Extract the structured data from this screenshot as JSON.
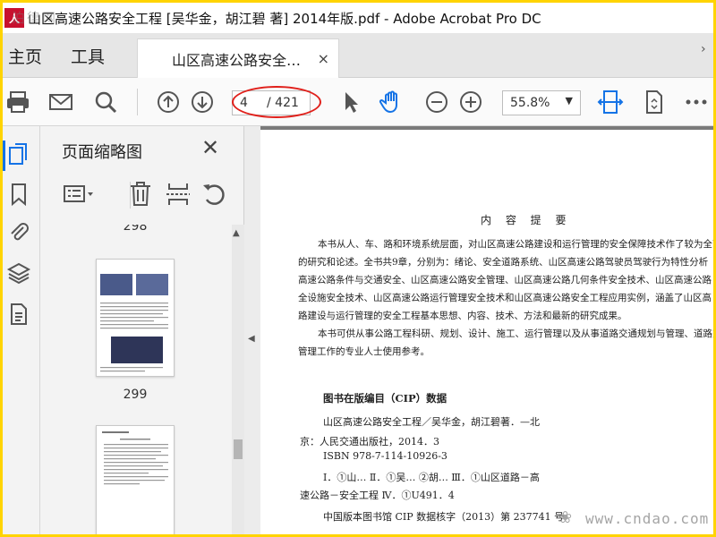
{
  "window": {
    "title": "山区高速公路安全工程 [吴华金，胡江碧 著] 2014年版.pdf - Adobe Acrobat Pro DC",
    "app_icon": "acrobat-icon",
    "watermark_top": "泊律网"
  },
  "menu": {
    "home": "主页",
    "tools": "工具"
  },
  "tab": {
    "label": "山区高速公路安全…",
    "close": "×"
  },
  "toolbar": {
    "icons": [
      "print-icon",
      "email-icon",
      "search-icon",
      "prev-page-icon",
      "next-page-icon",
      "select-cursor-icon",
      "hand-tool-icon",
      "zoom-out-icon",
      "zoom-in-icon",
      "fit-width-icon",
      "page-layout-icon",
      "more-icon"
    ],
    "page_current": "4",
    "page_total": "/ 421",
    "zoom": "55.8%"
  },
  "left_rail": {
    "icons": [
      "thumbnails-icon",
      "bookmark-icon",
      "attachment-icon",
      "layers-icon",
      "page-content-icon"
    ]
  },
  "thumbnail_panel": {
    "title": "页面缩略图",
    "close": "✕",
    "tools": [
      "options-icon",
      "delete-icon",
      "extract-icon",
      "rotate-icon"
    ],
    "partial_label": "298",
    "page_labels": [
      "299"
    ]
  },
  "document": {
    "heading": "内 容 提 要",
    "paragraph_lines": [
      "本书从人、车、路和环境系统层面，对山区高速公路建设和运行管理的安全保障技术作了较为全面",
      "的研究和论述。全书共9章，分别为：绪论、安全道路系统、山区高速公路驾驶员驾驶行为特性分析",
      "高速公路条件与交通安全、山区高速公路安全管理、山区高速公路几何条件安全技术、山区高速公路",
      "全设施安全技术、山区高速公路运行管理安全技术和山区高速公路安全工程应用实例，涵盖了山区高",
      "路建设与运行管理的安全工程基本思想、内容、技术、方法和最新的研究成果。",
      "本书可供从事公路工程科研、规划、设计、施工、运行管理以及从事道路交通规划与管理、道路交通",
      "管理工作的专业人士使用参考。"
    ],
    "cip_title": "图书在版编目（CIP）数据",
    "cip_lines": [
      "山区高速公路安全工程／吴华金，胡江碧著．—北",
      "京：人民交通出版社，2014．3",
      "ISBN 978-7-114-10926-3",
      "Ⅰ．①山…  Ⅱ．①吴…  ②胡…  Ⅲ．①山区道路－高",
      "速公路－安全工程  Ⅳ．①U491．4",
      "中国版本图书馆 CIP 数据核字（2013）第 237741 号"
    ]
  },
  "watermark_bottom": "www.cndao.com",
  "colors": {
    "frame": "#ffd400",
    "acrobat_red": "#c8102e",
    "accent_blue": "#1473e6",
    "highlight_red": "#e0201b"
  }
}
